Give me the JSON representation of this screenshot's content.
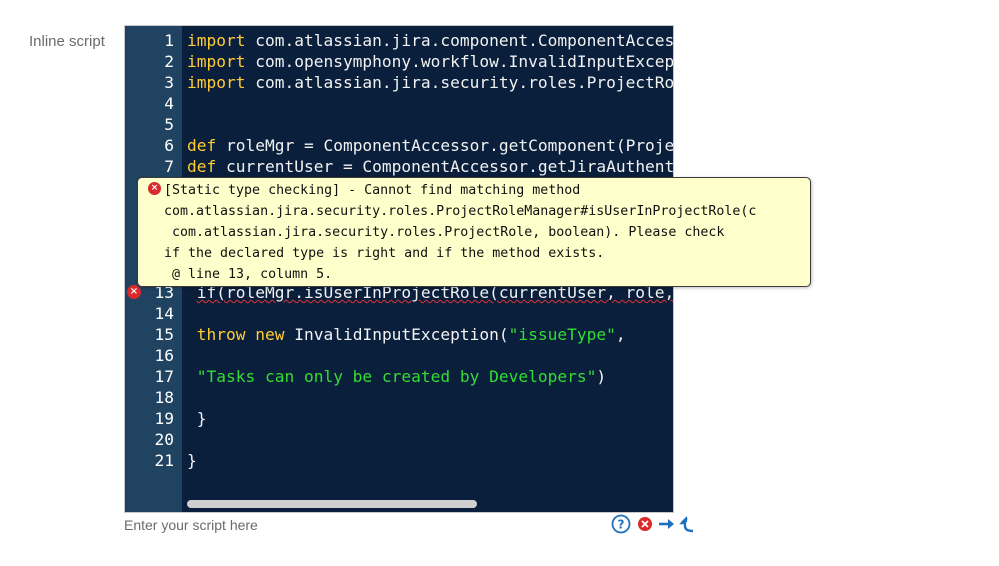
{
  "field_label": "Inline script",
  "hint": "Enter your script here",
  "editor": {
    "lines": [
      {
        "n": "1",
        "parts": [
          {
            "t": "import",
            "c": "kw"
          },
          {
            "t": " com.atlassian.jira.component.ComponentAccessor",
            "c": ""
          }
        ]
      },
      {
        "n": "2",
        "parts": [
          {
            "t": "import",
            "c": "kw"
          },
          {
            "t": " com.opensymphony.workflow.InvalidInputException",
            "c": ""
          }
        ]
      },
      {
        "n": "3",
        "parts": [
          {
            "t": "import",
            "c": "kw"
          },
          {
            "t": " com.atlassian.jira.security.roles.ProjectRoleManager",
            "c": ""
          }
        ]
      },
      {
        "n": "4",
        "parts": []
      },
      {
        "n": "5",
        "parts": []
      },
      {
        "n": "6",
        "parts": [
          {
            "t": "def",
            "c": "kw"
          },
          {
            "t": " roleMgr = ComponentAccessor.getComponent(ProjectRoleManager)",
            "c": ""
          }
        ]
      },
      {
        "n": "7",
        "parts": [
          {
            "t": "def",
            "c": "kw"
          },
          {
            "t": " currentUser = ComponentAccessor.getJiraAuthenticationContext()",
            "c": ""
          }
        ]
      },
      {
        "n": "13",
        "parts": [
          {
            "t": " ",
            "c": ""
          },
          {
            "t": "if(roleMgr.isUserInProjectRole(currentUser, role, is",
            "c": "sq"
          }
        ]
      },
      {
        "n": "14",
        "parts": []
      },
      {
        "n": "15",
        "parts": [
          {
            "t": " ",
            "c": ""
          },
          {
            "t": "throw",
            "c": "kw"
          },
          {
            "t": " ",
            "c": ""
          },
          {
            "t": "new",
            "c": "kw"
          },
          {
            "t": " InvalidInputException(",
            "c": ""
          },
          {
            "t": "\"issueType\"",
            "c": "str"
          },
          {
            "t": ",",
            "c": ""
          }
        ]
      },
      {
        "n": "16",
        "parts": []
      },
      {
        "n": "17",
        "parts": [
          {
            "t": " ",
            "c": ""
          },
          {
            "t": "\"Tasks can only be created by Developers\"",
            "c": "str"
          },
          {
            "t": ")",
            "c": ""
          }
        ]
      },
      {
        "n": "18",
        "parts": []
      },
      {
        "n": "19",
        "parts": [
          {
            "t": " }",
            "c": ""
          }
        ]
      },
      {
        "n": "20",
        "parts": []
      },
      {
        "n": "21",
        "parts": [
          {
            "t": "}",
            "c": ""
          }
        ]
      }
    ]
  },
  "tooltip": {
    "lines": [
      "[Static type checking] - Cannot find matching method",
      "com.atlassian.jira.security.roles.ProjectRoleManager#isUserInProjectRole(c",
      " com.atlassian.jira.security.roles.ProjectRole, boolean). Please check",
      "if the declared type is right and if the method exists.",
      " @ line 13, column 5."
    ]
  },
  "icons": {
    "error": "error-icon",
    "help": "help-icon",
    "next": "arrow-right-icon",
    "prev": "arrow-up-left-icon"
  },
  "colors": {
    "editor_bg": "#0a1f3c",
    "gutter_bg": "#1f4361",
    "keyword": "#ffcc33",
    "string": "#33dd33",
    "error": "#d92b2b",
    "accent": "#1f6fc1",
    "tooltip_bg": "#ffffcc"
  }
}
